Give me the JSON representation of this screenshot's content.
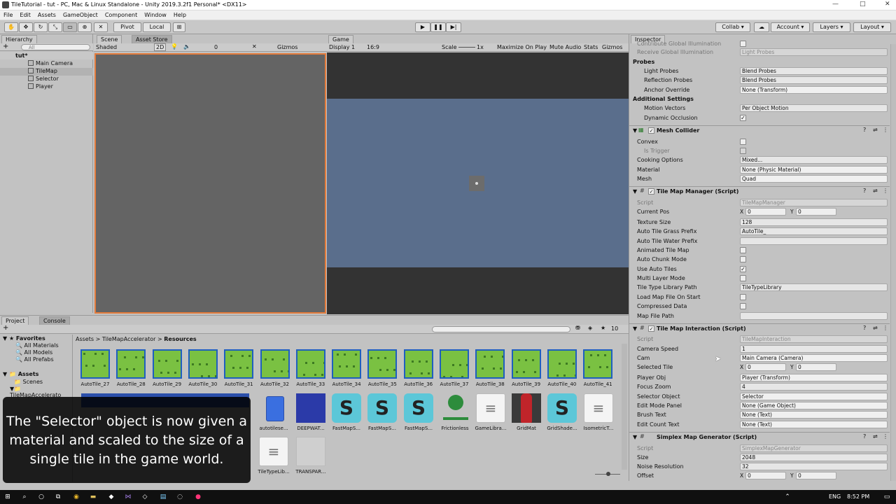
{
  "window": {
    "title": "TileTutorial - tut - PC, Mac & Linux Standalone - Unity 2019.3.2f1 Personal* <DX11>",
    "min": "—",
    "max": "□",
    "close": "✕"
  },
  "menu": [
    "File",
    "Edit",
    "Assets",
    "GameObject",
    "Component",
    "Window",
    "Help"
  ],
  "toolbar": {
    "pivot": "Pivot",
    "local": "Local",
    "collab": "Collab ▾",
    "account": "Account ▾",
    "layers": "Layers ▾",
    "layout": "Layout ▾"
  },
  "hierarchy": {
    "tab": "Hierarchy",
    "search": "All",
    "scene": "tut*",
    "items": [
      "Main Camera",
      "TileMap",
      "Selector",
      "Player"
    ]
  },
  "scene": {
    "tab": "Scene",
    "tab2": "Asset Store",
    "shaded": "Shaded",
    "mode2d": "2D",
    "gizmo_count": "0",
    "gizmos": "Gizmos"
  },
  "game": {
    "tab": "Game",
    "display": "Display 1",
    "aspect": "16:9",
    "scale_label": "Scale",
    "scale_value": "1x",
    "maximize": "Maximize On Play",
    "mute": "Mute Audio",
    "stats": "Stats",
    "gizmos": "Gizmos"
  },
  "inspector": {
    "tab": "Inspector",
    "top_rows": [
      {
        "label": "Contribute Global Illumination",
        "value": "",
        "type": "chk",
        "dis": true
      },
      {
        "label": "Receive Global Illumination",
        "value": "Light Probes",
        "type": "val",
        "dis": true
      }
    ],
    "probes_header": "Probes",
    "probes": [
      {
        "label": "Light Probes",
        "value": "Blend Probes"
      },
      {
        "label": "Reflection Probes",
        "value": "Blend Probes"
      },
      {
        "label": "Anchor Override",
        "value": "None (Transform)"
      }
    ],
    "additional_header": "Additional Settings",
    "additional": [
      {
        "label": "Motion Vectors",
        "value": "Per Object Motion"
      },
      {
        "label": "Dynamic Occlusion",
        "value": "✓"
      }
    ],
    "mesh_collider": {
      "title": "Mesh Collider",
      "rows": [
        {
          "label": "Convex",
          "value": ""
        },
        {
          "label": "Is Trigger",
          "value": ""
        },
        {
          "label": "Cooking Options",
          "value": "Mixed..."
        },
        {
          "label": "Material",
          "value": "None (Physic Material)"
        },
        {
          "label": "Mesh",
          "value": "Quad"
        }
      ]
    },
    "tile_map_manager": {
      "title": "Tile Map Manager (Script)",
      "rows": [
        {
          "label": "Script",
          "value": "TileMapManager"
        },
        {
          "label": "Current Pos",
          "x": "0",
          "y": "0"
        },
        {
          "label": "Texture Size",
          "value": "128"
        },
        {
          "label": "Auto Tile Grass Prefix",
          "value": "AutoTile_"
        },
        {
          "label": "Auto Tile Water Prefix",
          "value": ""
        },
        {
          "label": "Animated Tile Map",
          "value": ""
        },
        {
          "label": "Auto Chunk Mode",
          "value": ""
        },
        {
          "label": "Use Auto Tiles",
          "value": "✓"
        },
        {
          "label": "Multi Layer Mode",
          "value": ""
        },
        {
          "label": "Tile Type Library Path",
          "value": "TileTypeLibrary"
        },
        {
          "label": "Load Map File On Start",
          "value": ""
        },
        {
          "label": "Compressed Data",
          "value": ""
        },
        {
          "label": "Map File Path",
          "value": ""
        }
      ]
    },
    "tile_map_interaction": {
      "title": "Tile Map Interaction (Script)",
      "rows": [
        {
          "label": "Script",
          "value": "TileMapInteraction"
        },
        {
          "label": "Camera Speed",
          "value": "1"
        },
        {
          "label": "Cam",
          "value": "Main Camera (Camera)"
        },
        {
          "label": "Selected Tile",
          "x": "0",
          "y": "0"
        },
        {
          "label": "Player Obj",
          "value": "Player (Transform)"
        },
        {
          "label": "Focus Zoom",
          "value": "4"
        },
        {
          "label": "Selector Object",
          "value": "Selector"
        },
        {
          "label": "Edit Mode Panel",
          "value": "None (Game Object)"
        },
        {
          "label": "Brush Text",
          "value": "None (Text)"
        },
        {
          "label": "Edit Count Text",
          "value": "None (Text)"
        }
      ]
    },
    "simplex": {
      "title": "Simplex Map Generator (Script)",
      "rows": [
        {
          "label": "Script",
          "value": "SimplexMapGenerator"
        },
        {
          "label": "Size",
          "value": "2048"
        },
        {
          "label": "Noise Resolution",
          "value": "32"
        },
        {
          "label": "Offset",
          "x": "0",
          "y": "0"
        }
      ]
    }
  },
  "project": {
    "tab": "Project",
    "tab2": "Console",
    "favorites": "Favorites",
    "fav_items": [
      "All Materials",
      "All Models",
      "All Prefabs"
    ],
    "assets": "Assets",
    "asset_items": [
      "Scenes",
      "TileMapAccelerato"
    ],
    "breadcrumb": [
      "Assets",
      "TileMapAccelerator",
      "Resources"
    ],
    "count": "10",
    "row1": [
      "AutoTile_27",
      "AutoTile_28",
      "AutoTile_29",
      "AutoTile_30",
      "AutoTile_31",
      "AutoTile_32",
      "AutoTile_33",
      "AutoTile_34",
      "AutoTile_35",
      "AutoTile_36",
      "AutoTile_37",
      "AutoTile_38",
      "AutoTile_39",
      "AutoTile_40",
      "AutoTile_41"
    ],
    "row2": [
      "autotilese...",
      "DEEPWAT...",
      "FastMapS...",
      "FastMapS...",
      "FastMapS...",
      "Frictionless",
      "GameLibra...",
      "GridMat",
      "GridShade...",
      "IsometricT..."
    ],
    "row3": [
      "TileTypeLib...",
      "TRANSPAR..."
    ]
  },
  "caption": "The \"Selector\" object is now given a material and scaled to the size of a single tile in the game world.",
  "taskbar": {
    "lang": "ENG",
    "time": "8:52 PM"
  }
}
